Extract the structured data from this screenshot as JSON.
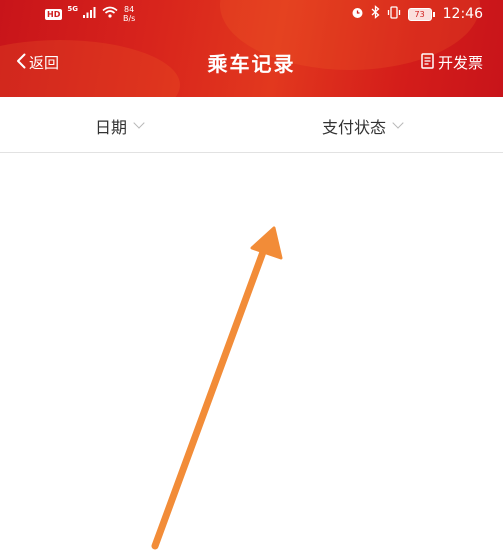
{
  "status_bar": {
    "hd_label": "HD",
    "network_label": "5G",
    "speed_value": "84",
    "speed_unit": "B/s",
    "battery_level": "73",
    "time": "12:46",
    "icons": [
      "signal-icon",
      "wifi-icon",
      "alarm-icon",
      "bluetooth-icon",
      "vibrate-icon",
      "battery-icon"
    ]
  },
  "nav": {
    "back_label": "返回",
    "title": "乘车记录",
    "invoice_label": "开发票"
  },
  "filters": {
    "date_label": "日期",
    "status_label": "支付状态"
  },
  "colors": {
    "header_red": "#d8241c",
    "annotation_arrow": "#f28c38",
    "divider": "#e2e2e2"
  }
}
